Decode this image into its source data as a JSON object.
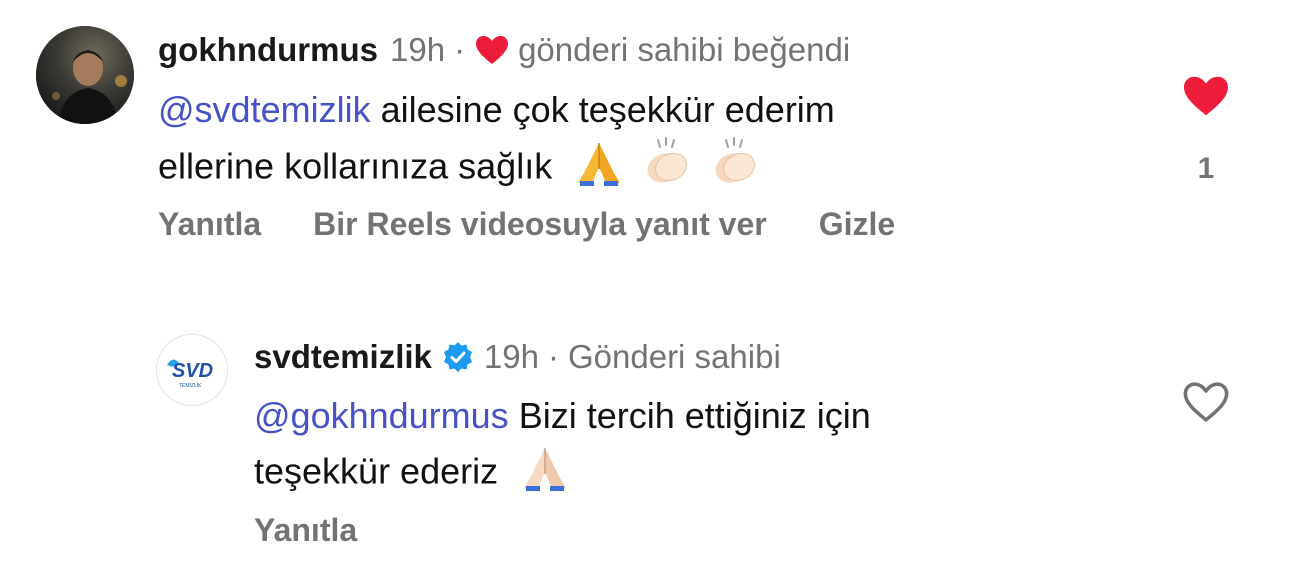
{
  "comments": [
    {
      "username": "gokhndurmus",
      "time": "19h",
      "separator": "·",
      "liked_by_owner_text": "gönderi sahibi beğendi",
      "mention": "@svdtemizlik",
      "text_line1_rest": "ailesine çok teşekkür ederim",
      "text_line2": "ellerine kollarınıza sağlık",
      "actions": {
        "reply": "Yanıtla",
        "reels_reply": "Bir Reels videosuyla yanıt ver",
        "hide": "Gizle"
      },
      "liked": true,
      "like_count": "1"
    },
    {
      "username": "svdtemizlik",
      "verified": true,
      "time": "19h",
      "separator": "·",
      "owner_label": "Gönderi sahibi",
      "logo_text": "SVD",
      "logo_subtext": "TEMİZLİK",
      "mention": "@gokhndurmus",
      "text_line1_rest": "Bizi tercih ettiğiniz için",
      "text_line2": "teşekkür ederiz",
      "actions": {
        "reply": "Yanıtla"
      },
      "liked": false
    }
  ],
  "colors": {
    "mention": "#4752c4",
    "heart_red": "#ed1c3a",
    "meta_gray": "#737373",
    "verified_blue": "#1d9bf0"
  }
}
